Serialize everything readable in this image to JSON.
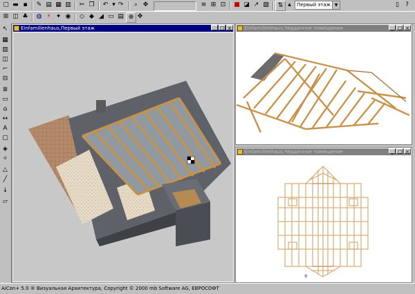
{
  "app": {
    "status_text": "AiCon+ 5.0 ® Визуальная Архитектура, Copyright © 2000 mb Software AG, EBPOCOФТ"
  },
  "toolbar": {
    "floor_select": "Первый этаж"
  },
  "windows": [
    {
      "title": "Einfamilienhaus,Первый этаж",
      "state": "active"
    },
    {
      "title": "Einfamilienhaus,Чердачное помещение",
      "state": "inactive"
    },
    {
      "title": "Einfamilienhaus,Чердачное помещение",
      "state": "inactive"
    }
  ],
  "colors": {
    "titlebar_active": "#000080",
    "titlebar_inactive": "#808080",
    "timber": "#c8924a",
    "roof_gray": "#777777",
    "workspace_gray": "#c8c8c8"
  }
}
